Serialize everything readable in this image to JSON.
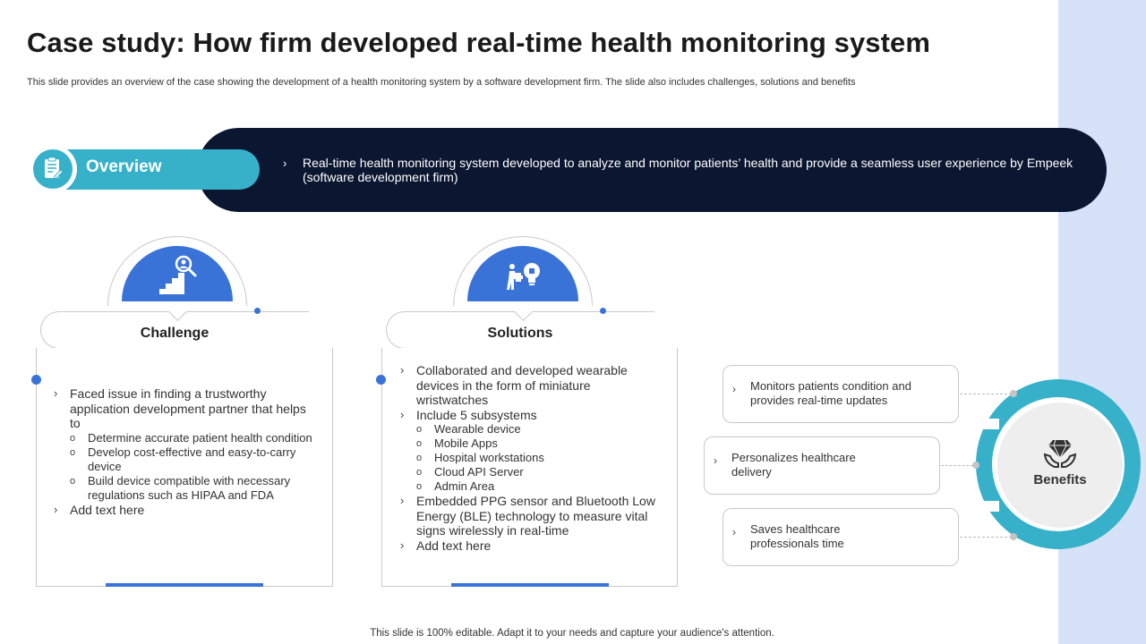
{
  "header": {
    "title": "Case study: How firm developed real-time health monitoring system",
    "subtitle": "This slide provides an overview of the case showing the development of a health monitoring system by a software development firm. The slide also includes challenges, solutions and benefits"
  },
  "overview": {
    "label": "Overview",
    "icon": "clipboard-icon",
    "bullet": "›",
    "text": "Real-time health monitoring system developed to analyze and monitor patients’ health and provide a seamless user experience by Empeek (software development firm)"
  },
  "challenge": {
    "label": "Challenge",
    "icon": "stairs-magnifier-icon",
    "items": [
      {
        "text": "Faced issue in finding a trustworthy application development partner that helps to",
        "sub": [
          "Determine accurate patient health condition",
          "Develop cost-effective and easy-to-carry device",
          "Build device compatible with necessary regulations such as HIPAA and FDA"
        ]
      },
      {
        "text": "Add text here",
        "sub": []
      }
    ]
  },
  "solutions": {
    "label": "Solutions",
    "icon": "puzzle-lightbulb-icon",
    "items": [
      {
        "text": "Collaborated and developed wearable devices in the form of miniature wristwatches",
        "sub": []
      },
      {
        "text": "Include 5 subsystems",
        "sub": [
          "Wearable device",
          "Mobile Apps",
          "Hospital workstations",
          "Cloud API Server",
          "Admin Area"
        ]
      },
      {
        "text": "Embedded PPG sensor and Bluetooth Low Energy (BLE) technology to measure vital signs wirelessly in real-time",
        "sub": []
      },
      {
        "text": "Add text here",
        "sub": []
      }
    ]
  },
  "benefits": {
    "label": "Benefits",
    "icon": "diamond-hands-icon",
    "items": [
      "Monitors patients condition and provides real-time updates",
      "Personalizes healthcare delivery",
      "Saves healthcare professionals time"
    ]
  },
  "footer": {
    "text": "This slide is 100% editable. Adapt it to your needs and capture your audience's attention."
  },
  "colors": {
    "navy": "#0b1630",
    "teal": "#36b1c9",
    "blue": "#3a73d8",
    "side_band": "#d6e2f7"
  }
}
